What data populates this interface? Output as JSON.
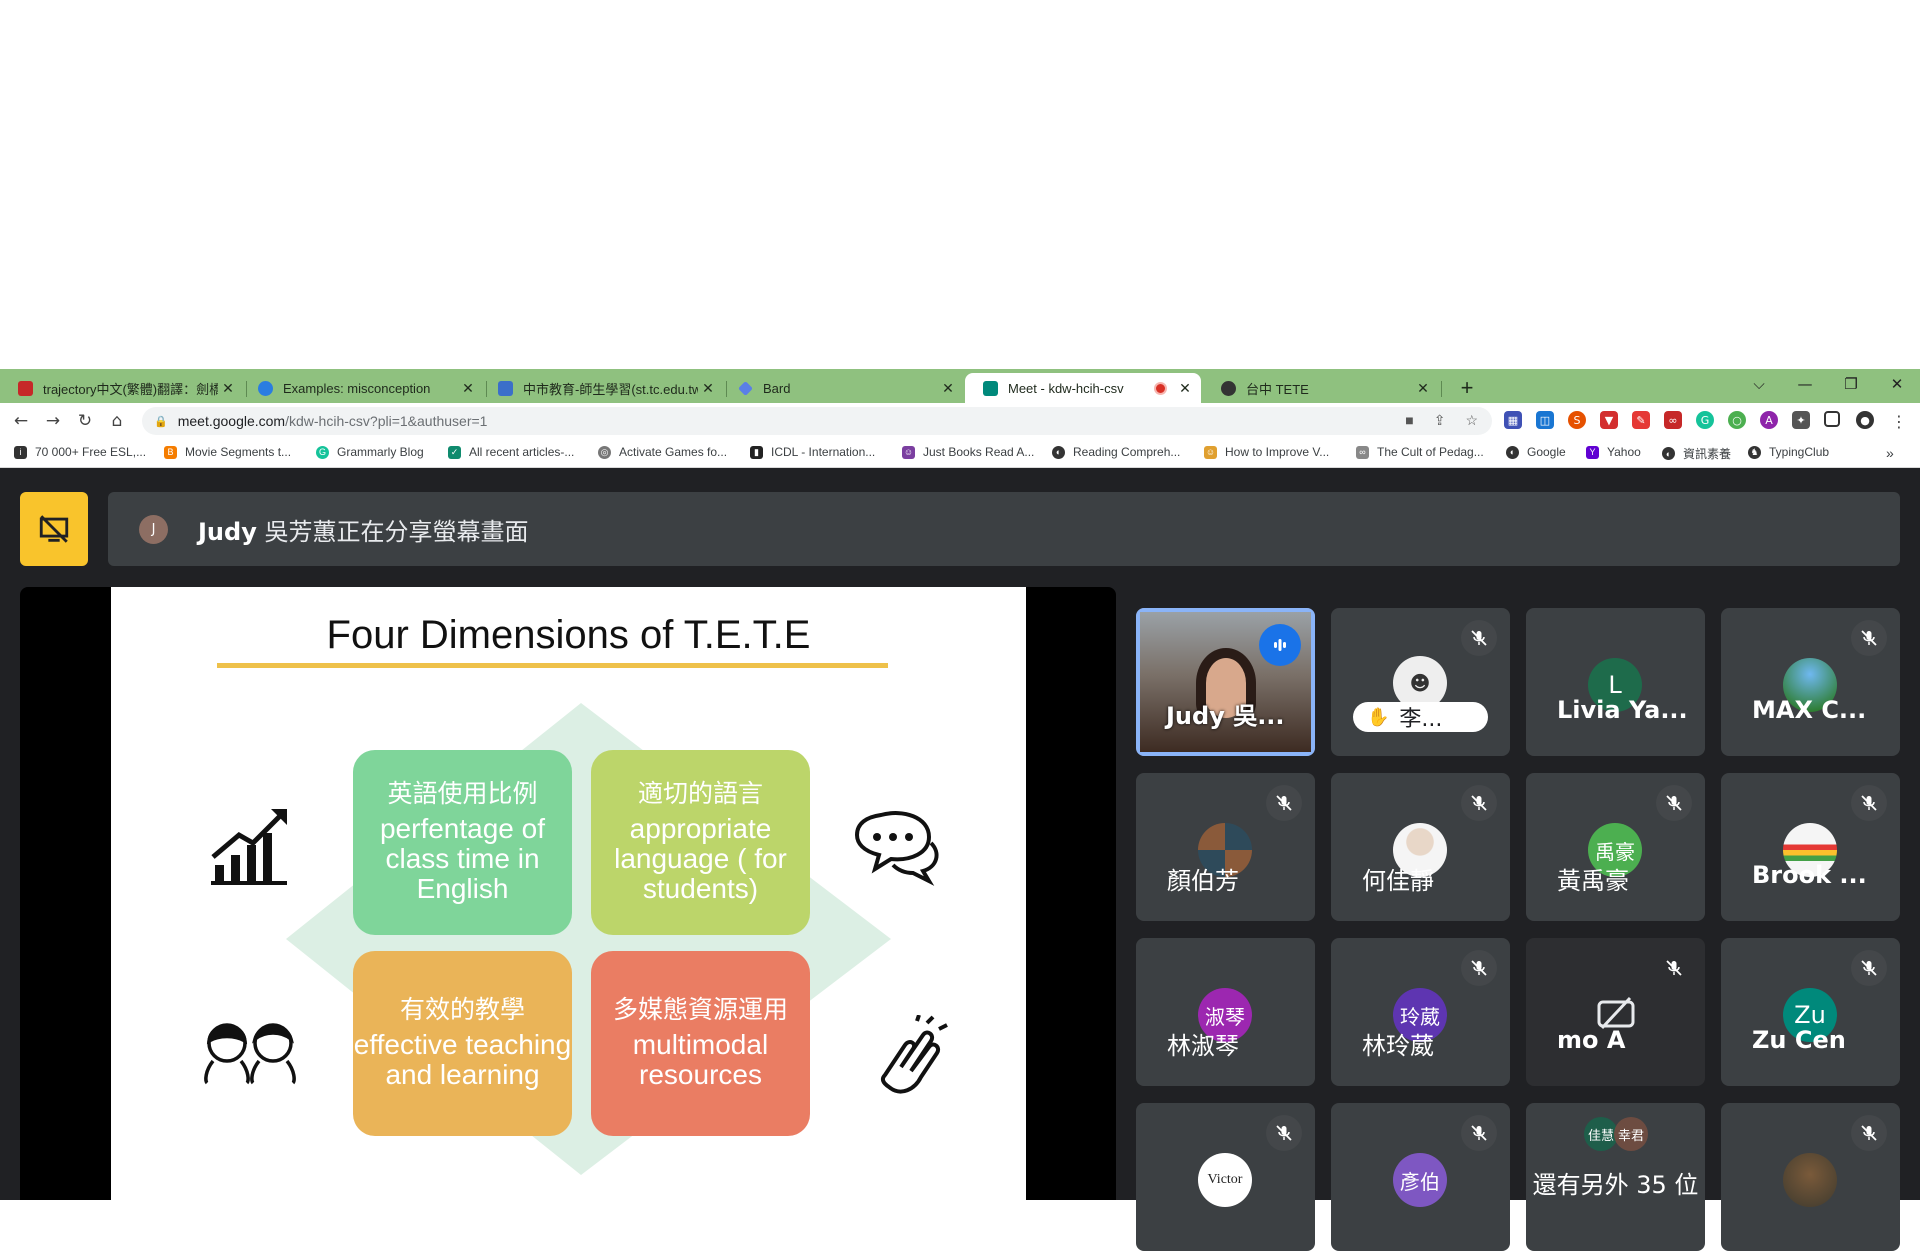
{
  "tabs": [
    {
      "title": "trajectory中文(繁體)翻譯：劍橋",
      "icon": "cambridge-icon",
      "color": "#c62828"
    },
    {
      "title": "Examples: misconception",
      "icon": "globe-icon",
      "color": "#2a7de1"
    },
    {
      "title": "中市教育-師生學習(st.tc.edu.tw)",
      "icon": "school-icon",
      "color": "#3b6fc9"
    },
    {
      "title": "Bard",
      "icon": "bard-icon",
      "color": "#5b7fe6"
    },
    {
      "title": "Meet - kdw-hcih-csv",
      "icon": "meet-icon",
      "color": "#00897b",
      "active": true,
      "recording": true
    },
    {
      "title": "台中 TETE",
      "icon": "avatar-icon",
      "color": "#333333"
    }
  ],
  "address": {
    "domain": "meet.google.com",
    "path": "/kdw-hcih-csv?pli=1&authuser=1"
  },
  "bookmarks": [
    {
      "label": "70 000+ Free ESL,...",
      "icon": "isl-icon",
      "color": "#333333"
    },
    {
      "label": "Movie Segments t...",
      "icon": "blogger-icon",
      "color": "#f57d00"
    },
    {
      "label": "Grammarly Blog",
      "icon": "grammarly-icon",
      "color": "#15c39a"
    },
    {
      "label": "All recent articles-...",
      "icon": "edutopia-icon",
      "color": "#0f8b6e"
    },
    {
      "label": "Activate Games fo...",
      "icon": "seal-icon",
      "color": "#777777"
    },
    {
      "label": "ICDL - Internation...",
      "icon": "icdl-icon",
      "color": "#222222"
    },
    {
      "label": "Just Books Read A...",
      "icon": "reader-icon",
      "color": "#7b3fa0"
    },
    {
      "label": "Reading Compreh...",
      "icon": "globe-icon",
      "color": "#333333"
    },
    {
      "label": "How to Improve V...",
      "icon": "reader-icon",
      "color": "#e0a030"
    },
    {
      "label": "The Cult of Pedag...",
      "icon": "link-icon",
      "color": "#888888"
    },
    {
      "label": "Google",
      "icon": "globe-icon",
      "color": "#333333"
    },
    {
      "label": "Yahoo",
      "icon": "yahoo-icon",
      "color": "#6001d2"
    },
    {
      "label": "資訊素養",
      "icon": "globe-icon",
      "color": "#333333"
    },
    {
      "label": "TypingClub",
      "icon": "typingclub-icon",
      "color": "#333333"
    }
  ],
  "banner": {
    "avatar_letter": "J",
    "presenter": "Judy",
    "message": " 吳芳蕙正在分享螢幕畫面"
  },
  "slide": {
    "title": "Four Dimensions of T.E.T.E",
    "boxes": [
      {
        "zh": "英語使用比例",
        "en": "perfentage of class time in English",
        "color": "#7fd59a"
      },
      {
        "zh": "適切的語言",
        "en": "appropriate language ( for students)",
        "color": "#bcd56a"
      },
      {
        "zh": "有效的教學",
        "en": "effective teaching and learning",
        "color": "#eab458"
      },
      {
        "zh": "多媒態資源運用",
        "en": "multimodal resources",
        "color": "#ea7d63"
      }
    ]
  },
  "participants": [
    {
      "name": "Judy 吳...",
      "type": "photo",
      "speaking": true
    },
    {
      "name": "李...",
      "type": "avatar-photo",
      "muted": true,
      "hand_raised": true
    },
    {
      "name": "Livia Ya...",
      "type": "letter",
      "letter": "L",
      "color": "#1e6b4b"
    },
    {
      "name": "MAX C...",
      "type": "avatar-photo",
      "muted": true
    },
    {
      "name": "顏伯芳",
      "type": "avatar-photo",
      "muted": true
    },
    {
      "name": "何佳靜",
      "type": "avatar-photo",
      "muted": true
    },
    {
      "name": "黃禹豪",
      "type": "letter",
      "letter": "禹豪",
      "color": "#4caf50",
      "muted": true
    },
    {
      "name": "Brook ...",
      "type": "avatar-photo",
      "muted": true
    },
    {
      "name": "林淑琴",
      "type": "letter",
      "letter": "淑琴",
      "color": "#9c27b0"
    },
    {
      "name": "林玲葳",
      "type": "letter",
      "letter": "玲葳",
      "color": "#5e35b1",
      "muted": true
    },
    {
      "name": "mo A",
      "type": "camera-off",
      "muted": true
    },
    {
      "name": "Zu Cen",
      "type": "letter",
      "letter": "Zu",
      "color": "#00897b",
      "muted": true
    },
    {
      "name": "",
      "type": "avatar-text",
      "letter": "Victor",
      "muted": true
    },
    {
      "name": "",
      "type": "letter",
      "letter": "彥伯",
      "color": "#7e57c2",
      "muted": true
    },
    {
      "name": "還有另外 35 位",
      "type": "others",
      "avatars": [
        "佳慧",
        "幸君"
      ]
    },
    {
      "name": "",
      "type": "avatar-photo",
      "muted": true
    }
  ]
}
